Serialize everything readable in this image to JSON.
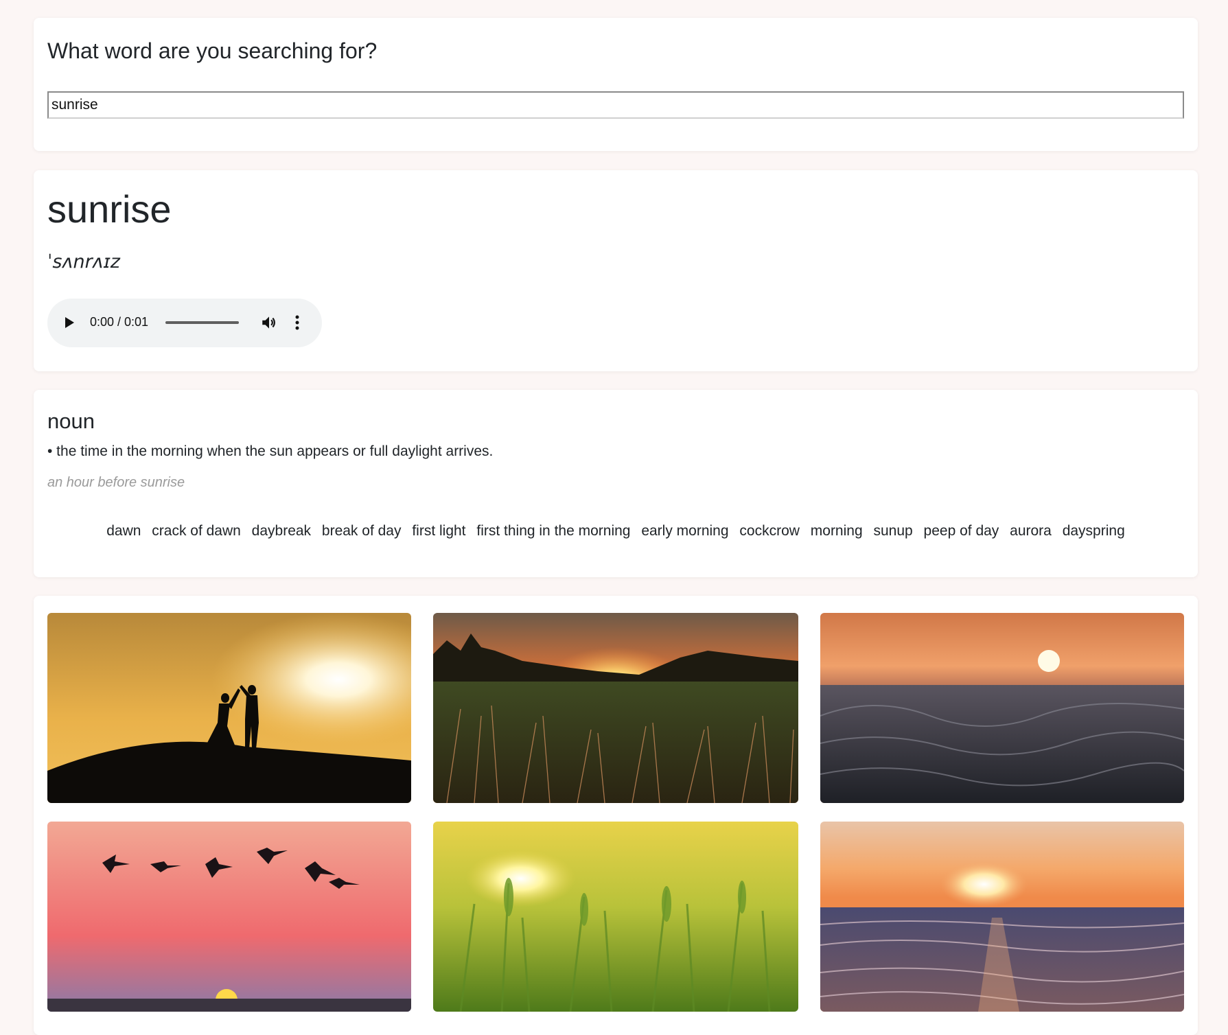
{
  "search": {
    "heading": "What word are you searching for?",
    "value": "sunrise"
  },
  "word": {
    "title": "sunrise",
    "phonetic": "ˈsʌnrʌɪz",
    "audio": {
      "time": "0:00 / 0:01",
      "progress": 0.0
    }
  },
  "meaning": {
    "part_of_speech": "noun",
    "definition": "• the time in the morning when the sun appears or full daylight arrives.",
    "example": "an hour before sunrise",
    "synonyms": [
      "dawn",
      "crack of dawn",
      "daybreak",
      "break of day",
      "first light",
      "first thing in the morning",
      "early morning",
      "cockcrow",
      "morning",
      "sunup",
      "peep of day",
      "aurora",
      "dayspring"
    ]
  },
  "gallery": {
    "photos": [
      {
        "subject": "couple silhouette on hill at sunset"
      },
      {
        "subject": "sun setting behind trees over grass field"
      },
      {
        "subject": "sun over ocean waves close-up"
      },
      {
        "subject": "birds flying over pink sunrise"
      },
      {
        "subject": "sun through green wheat stalks"
      },
      {
        "subject": "sunrise over ocean waves"
      }
    ]
  }
}
